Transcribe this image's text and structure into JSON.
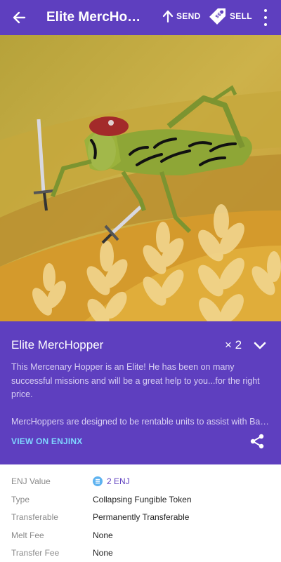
{
  "appbar": {
    "title": "Elite MercHopper",
    "send_label": "SEND",
    "sell_label": "SELL",
    "icons": [
      "back-arrow-icon",
      "upload-arrow-icon",
      "price-tag-icon",
      "more-vert-icon"
    ]
  },
  "item": {
    "name": "Elite MercHopper",
    "quantity": "× 2",
    "description": [
      "This Mercenary Hopper is an Elite!  He has been on many successful missions and will be a great help to you...for the right price.",
      "MercHoppers are designed to be rentable units to assist with Battles..."
    ],
    "view_link": "VIEW ON ENJINX"
  },
  "details": [
    {
      "key": "ENJ Value",
      "value": "2 ENJ",
      "icon": "enj-coin-icon"
    },
    {
      "key": "Type",
      "value": "Collapsing Fungible Token"
    },
    {
      "key": "Transferable",
      "value": "Permanently Transferable"
    },
    {
      "key": "Melt Fee",
      "value": "None"
    },
    {
      "key": "Transfer Fee",
      "value": "None"
    }
  ],
  "colors": {
    "primary": "#5e3fbf",
    "link": "#7fd6ff",
    "art_background": "#c9ab3c"
  }
}
